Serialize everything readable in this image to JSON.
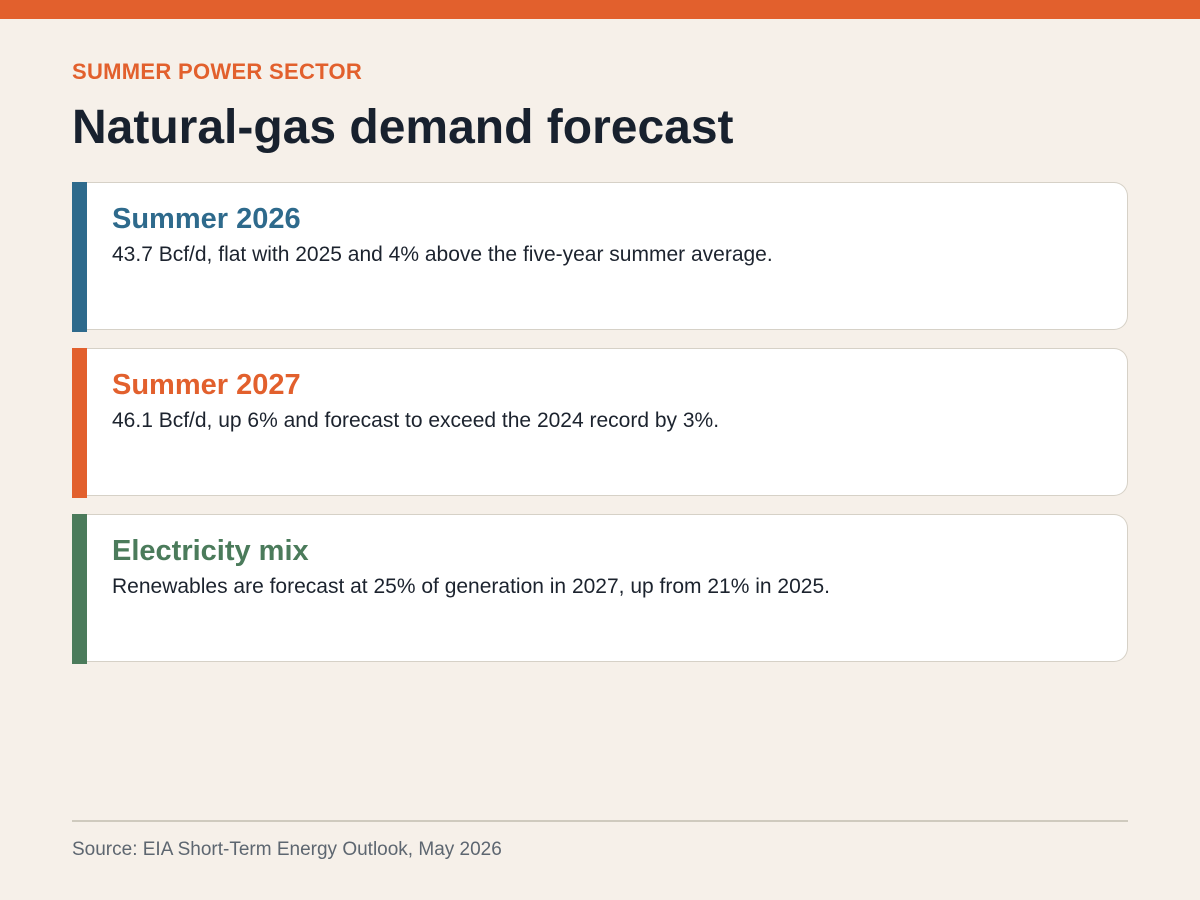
{
  "header": {
    "eyebrow": "SUMMER POWER SECTOR",
    "title": "Natural-gas demand forecast"
  },
  "cards": [
    {
      "heading": "Summer 2026",
      "body": "43.7 Bcf/d, flat with 2025 and 4% above the five-year summer average.",
      "accent_color": "#2e6a8c"
    },
    {
      "heading": "Summer 2027",
      "body": "46.1 Bcf/d, up 6% and forecast to exceed the 2024 record by 3%.",
      "accent_color": "#e2602d"
    },
    {
      "heading": "Electricity mix",
      "body": "Renewables are forecast at 25% of generation in 2027, up from 21% in 2025.",
      "accent_color": "#4b7b5b"
    }
  ],
  "footer": {
    "source": "Source: EIA Short-Term Energy Outlook, May 2026"
  },
  "colors": {
    "brand": "#e2602d",
    "background": "#f6f0e9",
    "title": "#18212e"
  }
}
